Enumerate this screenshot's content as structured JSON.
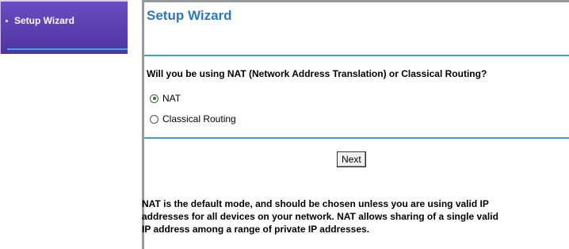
{
  "sidebar": {
    "items": [
      {
        "label": "Setup Wizard"
      }
    ]
  },
  "main": {
    "title": "Setup Wizard",
    "question": "Will you be using NAT (Network Address Translation) or Classical Routing?",
    "options": [
      {
        "label": "NAT",
        "checked": true
      },
      {
        "label": "Classical Routing",
        "checked": false
      }
    ],
    "next_label": "Next",
    "help_lines": [
      "NAT is the default mode, and should be chosen unless you are using valid IP",
      "addresses for all devices on your network. NAT allows sharing of a single valid",
      "IP address among a range of private IP addresses."
    ]
  },
  "colors": {
    "sidebar_bg": "#5b3fb0",
    "accent_blue": "#3aa0dc",
    "title_blue": "#2a78c8"
  }
}
